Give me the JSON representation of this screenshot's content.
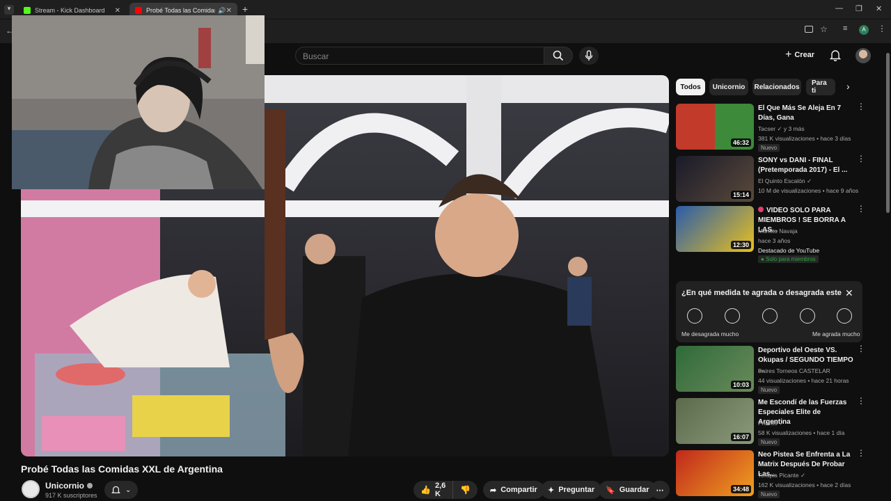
{
  "browser": {
    "tabs": [
      {
        "title": "Stream - Kick Dashboard",
        "active": false,
        "favicon_color": "#53fc18"
      },
      {
        "title": "Probé Todas las Comidas XXL",
        "active": true,
        "favicon_color": "#ff0000"
      }
    ],
    "new_tab_label": "+",
    "profile_initial": "A"
  },
  "header": {
    "search_placeholder": "Buscar",
    "create_label": "Crear"
  },
  "video": {
    "title": "Probé Todas las Comidas XXL de Argentina"
  },
  "channel": {
    "name": "Unicornio",
    "subscribers": "917 K suscriptores"
  },
  "actions": {
    "likes": "2,6 K",
    "share": "Compartir",
    "ask": "Preguntar",
    "save": "Guardar"
  },
  "sidebar": {
    "chips": [
      "Todos",
      "Unicornio",
      "Relacionados",
      "Para ti"
    ],
    "videos": [
      {
        "title": "El Que Más Se Aleja En 7 Días, Gana",
        "channel": "Tacser",
        "channel_extra": "y 3 más",
        "views_time": "381 K visualizaciones • hace 3 días",
        "duration": "46:32",
        "badge": "Nuevo",
        "thumb_colors": [
          "#c23a2a",
          "#3c8a3a"
        ]
      },
      {
        "title": "SONY vs DANI - FINAL (Pretemporada 2017) - El ...",
        "channel": "El Quinto Escalón",
        "views_time": "10 M de visualizaciones • hace 9 años",
        "duration": "15:14",
        "thumb_colors": [
          "#1a1a2a",
          "#5a4a3a"
        ]
      },
      {
        "title": "VIDEO SOLO PARA MIEMBROS ! SE BORRA A LAS...",
        "channel": "Markito Navaja",
        "views_time": "hace 3 años",
        "extra": "Destacado de YouTube",
        "members_badge": "Solo para miembros",
        "duration": "12:30",
        "thumb_colors": [
          "#2a5caa",
          "#e8c020"
        ]
      },
      {
        "title": "Deportivo del Oeste VS. Okupas / SEGUNDO TIEMPO ...",
        "channel": "Baires Torneos CASTELAR",
        "views_time": "44 visualizaciones • hace 21 horas",
        "duration": "10:03",
        "badge": "Nuevo",
        "thumb_colors": [
          "#2f6a3a",
          "#6a8a5a"
        ]
      },
      {
        "title": "Me Escondí de las Fuerzas Especiales Elite de Argentina",
        "channel": "Francis",
        "views_time": "58 K visualizaciones • hace 1 día",
        "duration": "16:07",
        "badge": "Nuevo",
        "thumb_colors": [
          "#5a6a4a",
          "#8a9a7a"
        ]
      },
      {
        "title": "Neo Pistea Se Enfrenta a La Matrix Después De Probar Las...",
        "channel": "Terapia Picante",
        "views_time": "162 K visualizaciones • hace 2 días",
        "duration": "34:48",
        "badge": "Nuevo",
        "thumb_colors": [
          "#c0281c",
          "#f0a020"
        ]
      }
    ],
    "survey": {
      "question": "¿En qué medida te agrada o desagrada este",
      "low_label": "Me desagrada mucho",
      "high_label": "Me agrada mucho"
    }
  },
  "colors": {
    "background": "#0f0f0f",
    "surface": "#272727",
    "text": "#f1f1f1",
    "secondary_text": "#aaaaaa",
    "members_green": "#2ba640"
  }
}
